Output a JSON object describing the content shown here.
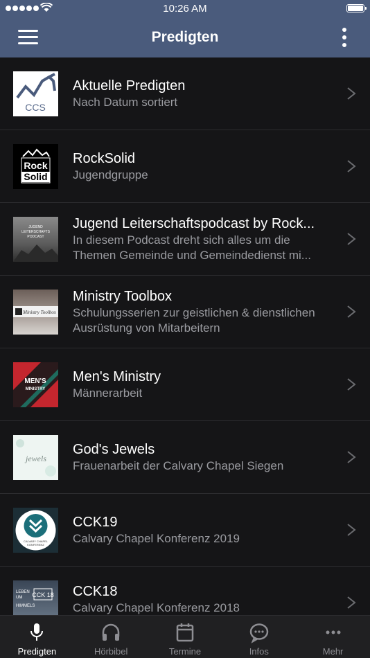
{
  "status": {
    "time": "10:26 AM"
  },
  "header": {
    "title": "Predigten"
  },
  "items": [
    {
      "title": "Aktuelle Predigten",
      "subtitle": "Nach Datum sortiert",
      "thumb_text": "CCS"
    },
    {
      "title": "RockSolid",
      "subtitle": "Jugendgruppe",
      "thumb_text": "Rock Solid"
    },
    {
      "title": "Jugend Leiterschaftspodcast by Rock...",
      "subtitle": "In diesem Podcast dreht sich alles um die Themen Gemeinde und Gemeindedienst mi...",
      "thumb_text": "JUGEND LEITERSCHAFTS PODCAST"
    },
    {
      "title": "Ministry Toolbox",
      "subtitle": "Schulungsserien zur geistlichen & dienstlichen Ausrüstung von Mitarbeitern",
      "thumb_text": "Ministry Toolbox"
    },
    {
      "title": "Men's Ministry",
      "subtitle": "Männerarbeit",
      "thumb_text": "MEN'S MINISTRY"
    },
    {
      "title": "God's Jewels",
      "subtitle": "Frauenarbeit der Calvary Chapel Siegen",
      "thumb_text": "jewels"
    },
    {
      "title": "CCK19",
      "subtitle": "Calvary Chapel Konferenz 2019",
      "thumb_text": "CALVARY CHAPEL KONFERENZ"
    },
    {
      "title": "CCK18",
      "subtitle": "Calvary Chapel Konferenz 2018",
      "thumb_text": "LEBEN UM CCK 18 HIMMELS"
    }
  ],
  "tabs": [
    {
      "label": "Predigten",
      "icon": "microphone-icon",
      "active": true
    },
    {
      "label": "Hörbibel",
      "icon": "headphones-icon",
      "active": false
    },
    {
      "label": "Termine",
      "icon": "calendar-icon",
      "active": false
    },
    {
      "label": "Infos",
      "icon": "chat-bubble-icon",
      "active": false
    },
    {
      "label": "Mehr",
      "icon": "more-dots-icon",
      "active": false
    }
  ],
  "colors": {
    "navbar": "#4a5b7c",
    "background": "#151517",
    "tabbar": "#202022",
    "subtitle": "#9a9ba0",
    "inactive_tab": "#8e8e93"
  }
}
